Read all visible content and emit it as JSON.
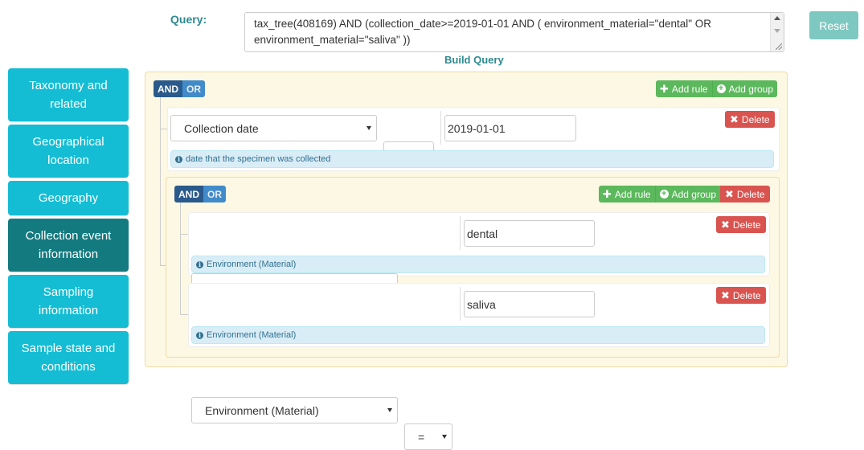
{
  "query": {
    "label": "Query:",
    "line1": "tax_tree(408169) AND (collection_date>=2019-01-01 AND ( environment_material=\"dental\" OR",
    "line2": "environment_material=\"saliva\" ))",
    "reset_label": "Reset",
    "build_label": "Build Query"
  },
  "sidebar": {
    "items": [
      {
        "line1": "Taxonomy and",
        "line2": "related"
      },
      {
        "line1": "Geographical",
        "line2": "location"
      },
      {
        "line1": "Geography",
        "line2": ""
      },
      {
        "line1": "Collection event",
        "line2": "information"
      },
      {
        "line1": "Sampling",
        "line2": "information"
      },
      {
        "line1": "Sample state and",
        "line2": "conditions"
      }
    ],
    "active_index": 3
  },
  "builder": {
    "and_label": "AND",
    "or_label": "OR",
    "add_rule_label": "Add rule",
    "add_group_label": "Add group",
    "delete_label": "Delete",
    "rule1": {
      "field": "Collection date",
      "operator": ">=",
      "value": "2019-01-01",
      "help": "date that the specimen was collected"
    },
    "rule2": {
      "field": "Environment (Material)",
      "operator": "=",
      "value": "dental",
      "help": "Environment (Material)"
    },
    "rule3": {
      "field": "Environment (Material)",
      "operator": "=",
      "value": "saliva",
      "help": "Environment (Material)"
    }
  },
  "colors": {
    "accent": "#2e8a8f",
    "sidebar": "#14bdd4",
    "sidebar_active": "#137a7f",
    "success": "#5cb85c",
    "danger": "#d9534f"
  }
}
